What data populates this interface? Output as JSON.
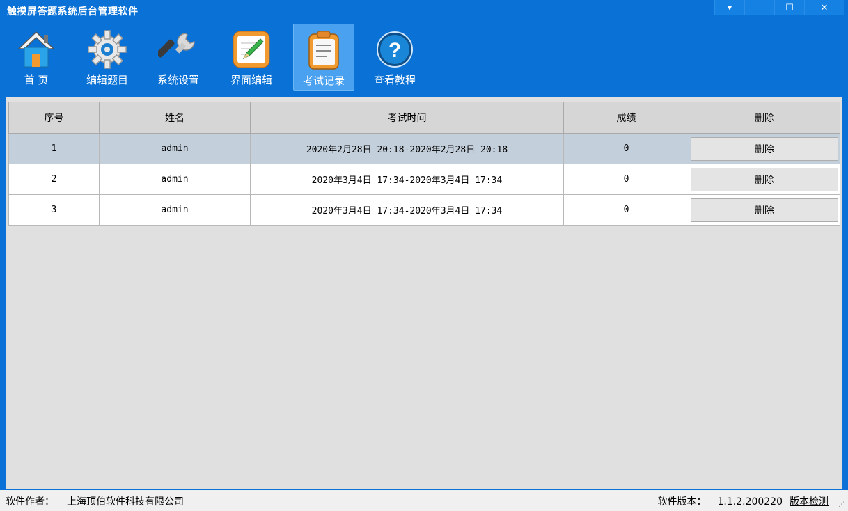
{
  "app": {
    "title": "触摸屏答题系统后台管理软件"
  },
  "window_controls": {
    "menu": "▾",
    "minimize": "—",
    "maximize": "☐",
    "close": "✕"
  },
  "toolbar": {
    "items": [
      {
        "label": "首  页",
        "icon": "home-icon"
      },
      {
        "label": "编辑题目",
        "icon": "gear-icon"
      },
      {
        "label": "系统设置",
        "icon": "wrench-icon"
      },
      {
        "label": "界面编辑",
        "icon": "edit-pencil-icon"
      },
      {
        "label": "考试记录",
        "icon": "clipboard-icon",
        "active": true
      },
      {
        "label": "查看教程",
        "icon": "help-icon"
      }
    ]
  },
  "table": {
    "headers": [
      "序号",
      "姓名",
      "考试时间",
      "成绩",
      "删除"
    ],
    "rows": [
      {
        "index": "1",
        "name": "admin",
        "time": "2020年2月28日 20:18-2020年2月28日 20:18",
        "score": "0",
        "delete": "删除",
        "selected": true
      },
      {
        "index": "2",
        "name": "admin",
        "time": "2020年3月4日 17:34-2020年3月4日 17:34",
        "score": "0",
        "delete": "删除"
      },
      {
        "index": "3",
        "name": "admin",
        "time": "2020年3月4日 17:34-2020年3月4日 17:34",
        "score": "0",
        "delete": "删除"
      }
    ]
  },
  "status": {
    "author_label": "软件作者：",
    "author_value": "上海顶伯软件科技有限公司",
    "version_label": "软件版本：",
    "version_value": "1.1.2.200220",
    "check_link": "版本检测"
  },
  "colors": {
    "accent": "#0a72d6",
    "active_tab": "#4aa1ef",
    "selected_row": "#c3cfdb"
  }
}
